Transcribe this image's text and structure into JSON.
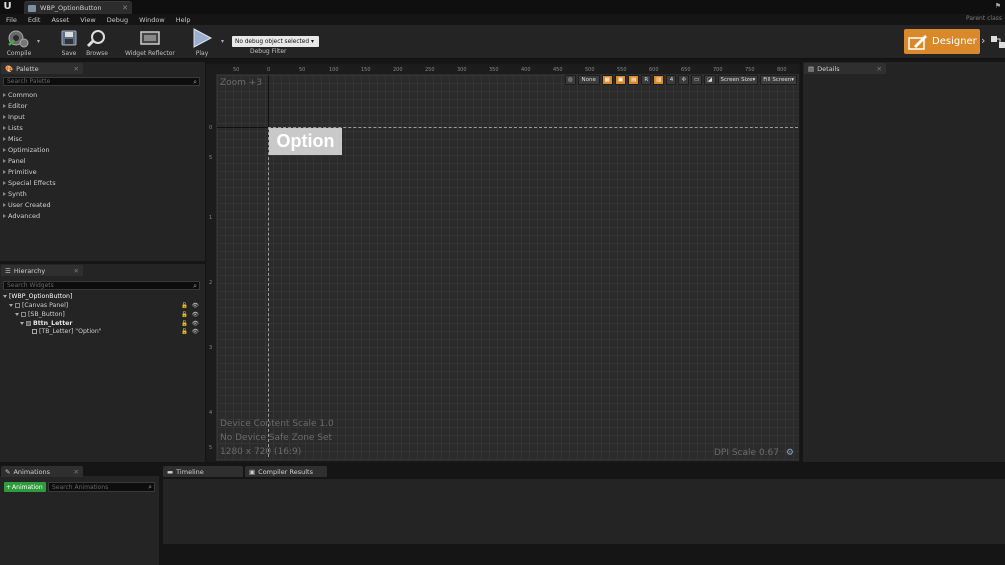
{
  "window": {
    "logo": "U",
    "tab_title": "WBP_OptionButton",
    "parent_class": "Parent class"
  },
  "menu": [
    "File",
    "Edit",
    "Asset",
    "View",
    "Debug",
    "Window",
    "Help"
  ],
  "toolbar": {
    "compile": "Compile",
    "save": "Save",
    "browse": "Browse",
    "widget_reflector": "Widget Reflector",
    "play": "Play",
    "debug_select": "No debug object selected",
    "debug_filter": "Debug Filter",
    "designer": "Designer"
  },
  "palette": {
    "tab": "Palette",
    "search_placeholder": "Search Palette",
    "categories": [
      "Common",
      "Editor",
      "Input",
      "Lists",
      "Misc",
      "Optimization",
      "Panel",
      "Primitive",
      "Special Effects",
      "Synth",
      "User Created",
      "Advanced"
    ]
  },
  "hierarchy": {
    "tab": "Hierarchy",
    "search_placeholder": "Search Widgets",
    "root": "[WBP_OptionButton]",
    "items": [
      "[Canvas Panel]",
      "[SB_Button]",
      "Bttn_Letter",
      "[TB_Letter] \"Option\""
    ]
  },
  "viewport": {
    "zoom": "Zoom +3",
    "widget_text": "Option",
    "ruler_top": [
      "50",
      "0",
      "50",
      "100",
      "150",
      "200",
      "250",
      "300",
      "350",
      "400",
      "450",
      "500",
      "550",
      "600",
      "650",
      "700",
      "750",
      "800"
    ],
    "ruler_left": [
      "0",
      "5",
      "1",
      "2",
      "3",
      "4",
      "5"
    ],
    "tools": {
      "none": "None",
      "r": "R",
      "four": "4",
      "screen_size": "Screen Size",
      "fill_screen": "Fill Screen"
    },
    "device_scale": "Device Content Scale 1.0",
    "safe_zone": "No Device Safe Zone Set",
    "resolution": "1280 x 720 (16:9)",
    "dpi": "DPI Scale 0.67"
  },
  "details": {
    "tab": "Details"
  },
  "animations": {
    "tab": "Animations",
    "add_button": "Animation",
    "search_placeholder": "Search Animations"
  },
  "bottom_tabs": {
    "timeline": "Timeline",
    "compiler": "Compiler Results"
  },
  "colors": {
    "accent": "#d9892a",
    "add_green": "#2f9c3c"
  }
}
